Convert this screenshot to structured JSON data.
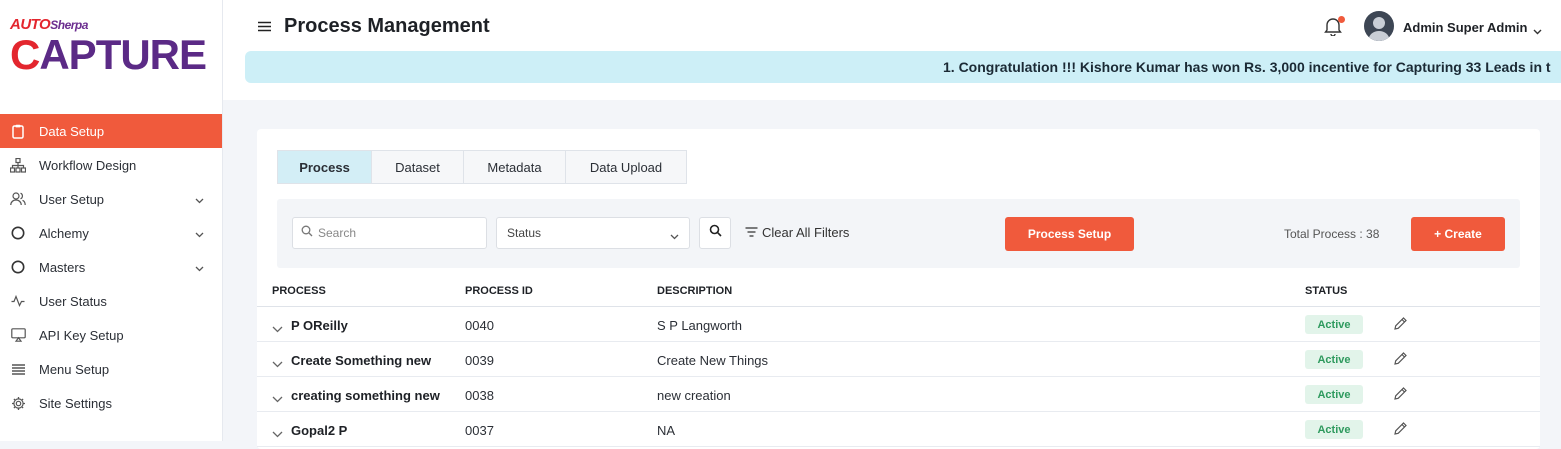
{
  "brand": {
    "small_auto": "AUTO",
    "small_sherpa": "Sherpa",
    "big_c": "C",
    "big_rest": "APTURE"
  },
  "sidebar": {
    "items": [
      {
        "label": "Data Setup",
        "icon": "clipboard-icon",
        "active": true
      },
      {
        "label": "Workflow Design",
        "icon": "sitemap-icon"
      },
      {
        "label": "User Setup",
        "icon": "users-icon",
        "expandable": true
      },
      {
        "label": "Alchemy",
        "icon": "circle-icon",
        "expandable": true
      },
      {
        "label": "Masters",
        "icon": "circle-icon",
        "expandable": true
      },
      {
        "label": "User Status",
        "icon": "activity-icon"
      },
      {
        "label": "API Key Setup",
        "icon": "monitor-icon"
      },
      {
        "label": "Menu Setup",
        "icon": "menu-lines-icon"
      },
      {
        "label": "Site Settings",
        "icon": "gear-icon"
      }
    ]
  },
  "header": {
    "title": "Process Management",
    "user_name": "Admin Super Admin",
    "ticker": "1. Congratulation !!! Kishore Kumar has won Rs. 3,000 incentive for Capturing 33 Leads in t"
  },
  "tabs": [
    "Process",
    "Dataset",
    "Metadata",
    "Data Upload"
  ],
  "filters": {
    "search_placeholder": "Search",
    "status_placeholder": "Status",
    "clear_label": "Clear All Filters",
    "process_setup_label": "Process Setup",
    "total_label": "Total Process : 38",
    "create_label": "+ Create"
  },
  "table": {
    "headers": {
      "process": "PROCESS",
      "process_id": "PROCESS ID",
      "description": "DESCRIPTION",
      "status": "STATUS"
    },
    "rows": [
      {
        "process": "P OReilly",
        "process_id": "0040",
        "description": "S P Langworth",
        "status": "Active"
      },
      {
        "process": "Create Something new",
        "process_id": "0039",
        "description": "Create New Things",
        "status": "Active"
      },
      {
        "process": "creating something new",
        "process_id": "0038",
        "description": "new creation",
        "status": "Active"
      },
      {
        "process": "Gopal2 P",
        "process_id": "0037",
        "description": "NA",
        "status": "Active"
      }
    ]
  },
  "colors": {
    "accent": "#f05a3c",
    "tab_active": "#d3eef6",
    "ticker_bg": "#cdeff7",
    "badge_bg": "#e2f4ea",
    "badge_text": "#2e9a5e"
  }
}
